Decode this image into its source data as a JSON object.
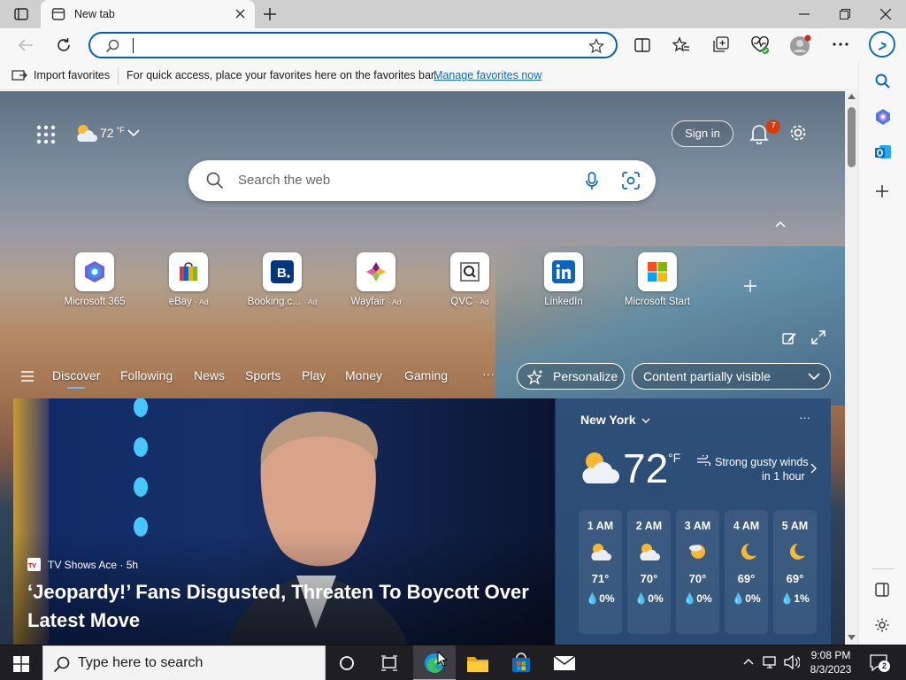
{
  "browser": {
    "tab_title": "New tab",
    "address_value": "",
    "favbar": {
      "import_label": "Import favorites",
      "hint_text": "For quick access, place your favorites here on the favorites bar.",
      "manage_link": "Manage favorites now"
    }
  },
  "newtab": {
    "weather_chip": {
      "temp": "72",
      "unit": "°F"
    },
    "sign_in_label": "Sign in",
    "notification_count": "7",
    "search_placeholder": "Search the web",
    "quick_links": [
      {
        "label": "Microsoft 365",
        "ad": ""
      },
      {
        "label": "eBay",
        "ad": "· Ad"
      },
      {
        "label": "Booking.c...",
        "ad": "· Ad"
      },
      {
        "label": "Wayfair",
        "ad": "· Ad"
      },
      {
        "label": "QVC",
        "ad": "· Ad"
      },
      {
        "label": "LinkedIn",
        "ad": ""
      },
      {
        "label": "Microsoft Start",
        "ad": ""
      }
    ],
    "feed_tabs": [
      "Discover",
      "Following",
      "News",
      "Sports",
      "Play",
      "Money",
      "Gaming"
    ],
    "more_label": "···",
    "personalize_label": "Personalize",
    "content_select": "Content partially visible",
    "hero": {
      "source": "TV Shows Ace · 5h",
      "headline": "‘Jeopardy!’ Fans Disgusted, Threaten To Boycott Over Latest Move"
    },
    "weather": {
      "city": "New York",
      "temp": "72",
      "unit": "°F",
      "alert_line1": "Strong gusty winds",
      "alert_line2": "in 1 hour",
      "hourly": [
        {
          "time": "1 AM",
          "temp": "71°",
          "precip": "0%",
          "icon": "partly-cloudy-night"
        },
        {
          "time": "2 AM",
          "temp": "70°",
          "precip": "0%",
          "icon": "partly-cloudy-night"
        },
        {
          "time": "3 AM",
          "temp": "70°",
          "precip": "0%",
          "icon": "partly-cloudy-night"
        },
        {
          "time": "4 AM",
          "temp": "69°",
          "precip": "0%",
          "icon": "moon"
        },
        {
          "time": "5 AM",
          "temp": "69°",
          "precip": "1%",
          "icon": "moon"
        }
      ]
    }
  },
  "taskbar": {
    "search_placeholder": "Type here to search",
    "time": "9:08 PM",
    "date": "8/3/2023",
    "notification_count": "2"
  },
  "colors": {
    "accent": "#005fb8",
    "badge": "#d83b01",
    "taskbar": "#1f1f23"
  }
}
